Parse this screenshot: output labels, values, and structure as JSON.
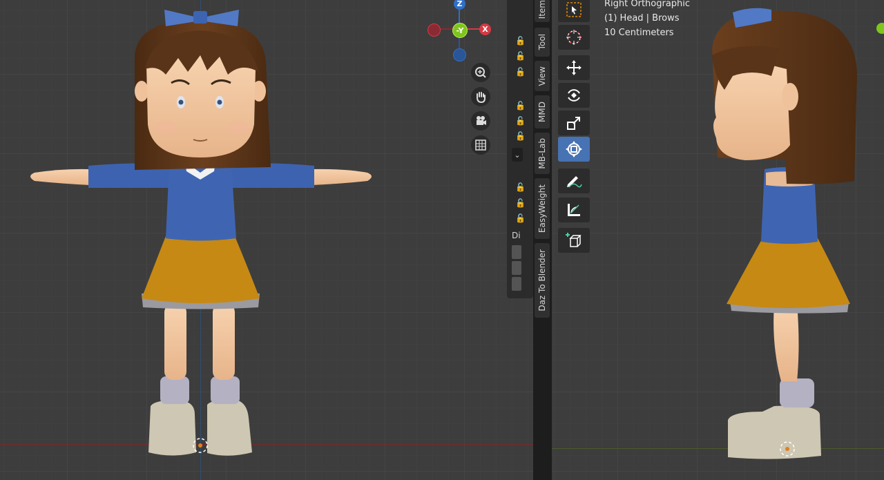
{
  "viewport_right": {
    "view_name": "Right Orthographic",
    "object_info": "(1) Head | Brows",
    "scale_info": "10 Centimeters"
  },
  "gizmo": {
    "z_label": "Z",
    "y_label": "-Y",
    "x_label": "X",
    "colors": {
      "z": "#2f6fc9",
      "y": "#7fc61c",
      "x": "#d63a44",
      "neg_x": "#8a2a33",
      "neg_z": "#2a5596"
    }
  },
  "sidebar_tabs": [
    "Item",
    "Tool",
    "View",
    "MMD",
    "MB-Lab",
    "EasyWeight",
    "Daz To Blender"
  ],
  "panel": {
    "dropdown_glyph": "⌄",
    "di_label": "Di",
    "lock_glyph": "🔓"
  },
  "nav_icons": [
    "zoom-icon",
    "hand-pan-icon",
    "camera-icon",
    "grid-icon"
  ],
  "tools": [
    "select-box",
    "cursor",
    "move",
    "rotate",
    "scale",
    "transform",
    "annotate",
    "measure",
    "add-cube"
  ],
  "active_tool": "transform",
  "colors": {
    "accent": "#4772b3",
    "background": "#3d3d3d",
    "shirt": "#3d63b0",
    "skirt": "#c88a16",
    "hair": "#5a3418",
    "skin": "#f0c29c",
    "shoe": "#cfc9b6"
  }
}
